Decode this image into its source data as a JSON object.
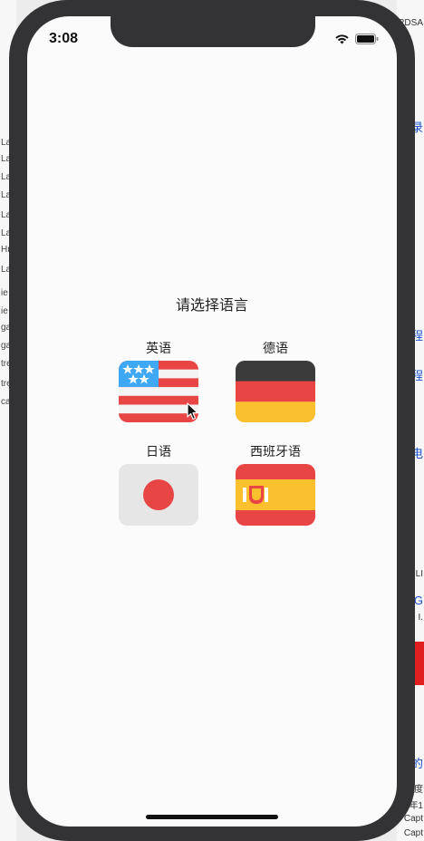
{
  "status_bar": {
    "time": "3:08"
  },
  "page": {
    "title": "请选择语言"
  },
  "languages": [
    {
      "label": "英语",
      "flag": "us-flag-icon"
    },
    {
      "label": "德语",
      "flag": "germany-flag-icon"
    },
    {
      "label": "日语",
      "flag": "japan-flag-icon"
    },
    {
      "label": "西班牙语",
      "flag": "spain-flag-icon"
    }
  ],
  "colors": {
    "flag_red": "#e84545",
    "flag_blue": "#3fa8f4",
    "flag_black": "#3b3b3b",
    "flag_yellow": "#fbc02d",
    "japan_bg": "#e6e6e6"
  },
  "backdrop": {
    "left_fragments": [
      "La",
      "La",
      "La",
      "La",
      "La",
      "La",
      "Hn",
      "La",
      "ie",
      "ie",
      "ga",
      "ga",
      "tre",
      "tre",
      "ca"
    ],
    "right_fragments": [
      "RDSA",
      "录",
      "程",
      "程",
      "电",
      "LI",
      "I.",
      "G",
      "的",
      "度",
      "年1",
      "Capt",
      "Capt"
    ]
  }
}
